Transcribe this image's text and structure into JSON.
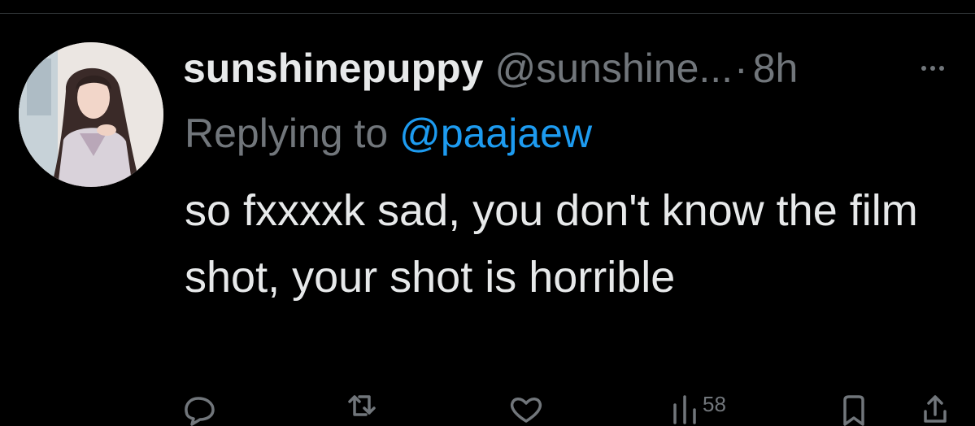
{
  "tweet": {
    "display_name": "sunshinepuppy",
    "handle": "@sunshine...",
    "separator": "·",
    "time": "8h",
    "more_icon": "more-horizontal-icon",
    "reply_prefix": "Replying to",
    "reply_to": "@paajaew",
    "text": "so fxxxxk sad, you don't know the film shot, your shot is horrible"
  },
  "actions": {
    "reply_icon": "comment-icon",
    "retweet_icon": "retweet-icon",
    "like_icon": "heart-icon",
    "views_icon": "views-bar-chart-icon",
    "views_count": "58",
    "bookmark_icon": "bookmark-icon",
    "share_icon": "share-icon"
  },
  "colors": {
    "background": "#000000",
    "text_primary": "#e7e9ea",
    "text_secondary": "#71767b",
    "link": "#1d9bf0",
    "divider": "#2f3336"
  }
}
